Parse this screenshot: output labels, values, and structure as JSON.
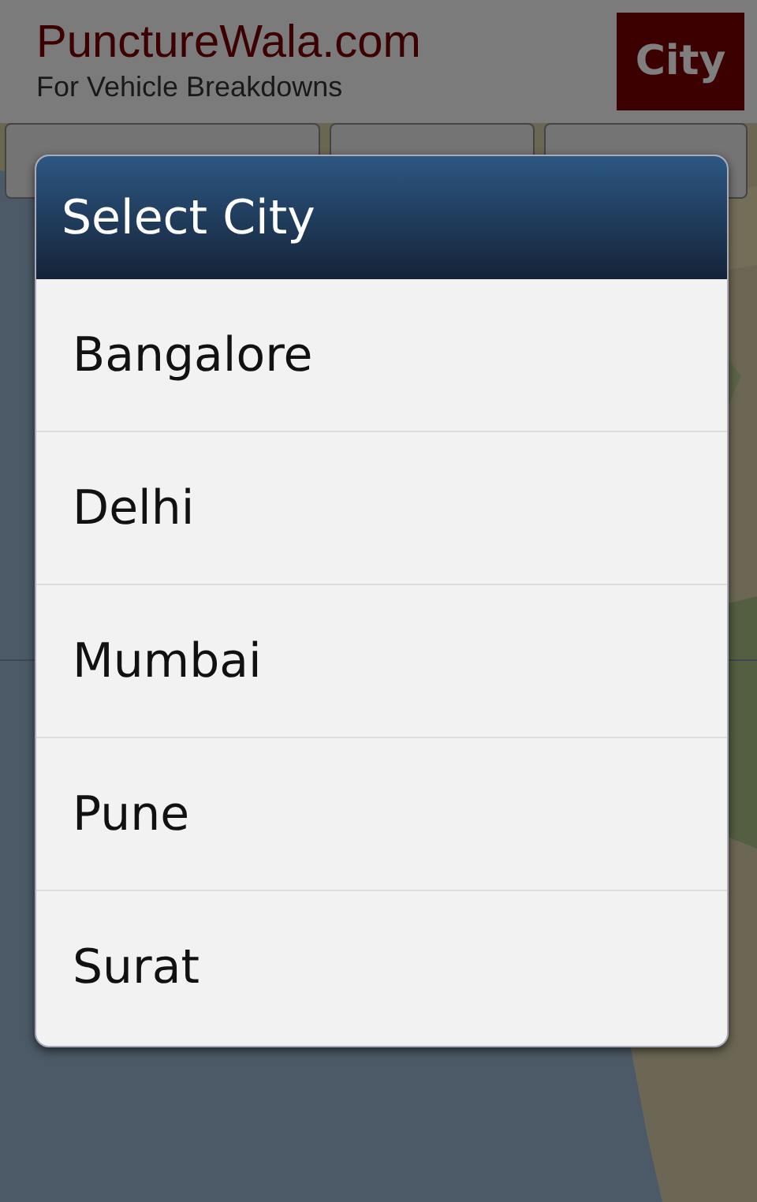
{
  "header": {
    "title": "PunctureWala.com",
    "subtitle": "For Vehicle Breakdowns",
    "city_button": "City"
  },
  "dialog": {
    "title": "Select City",
    "items": [
      {
        "label": "Bangalore"
      },
      {
        "label": "Delhi"
      },
      {
        "label": "Mumbai"
      },
      {
        "label": "Pune"
      },
      {
        "label": "Surat"
      }
    ]
  }
}
